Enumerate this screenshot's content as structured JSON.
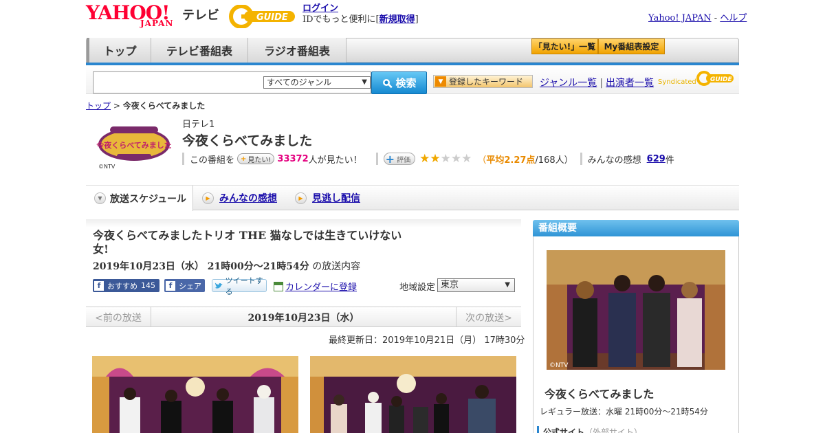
{
  "header": {
    "logo_yahoo": "YAHOO!",
    "logo_japan": "JAPAN",
    "logo_tv": "テレビ",
    "gguide": "G-GUIDE",
    "login_label": "ログイン",
    "login_prompt": "IDでもっと便利に[",
    "signup_label": "新規取得",
    "login_close": "]",
    "yahoo_japan_link": "Yahoo! JAPAN",
    "separator": "-",
    "help_link": "ヘルプ"
  },
  "nav": {
    "tabs": [
      {
        "label": "トップ"
      },
      {
        "label": "テレビ番組表"
      },
      {
        "label": "ラジオ番組表"
      }
    ],
    "mitai_list": "「見たい!」一覧",
    "my_schedule": "My番組表設定"
  },
  "search": {
    "placeholder": "",
    "genre_selected": "すべてのジャンル",
    "button_label": "検索",
    "keyword_button": "登録したキーワード",
    "genre_list_link": "ジャンル一覧",
    "performer_list_link": "出演者一覧",
    "syndicated": "Syndicated",
    "syndicated_brand": "G-GUIDE"
  },
  "breadcrumb": {
    "top": "トップ",
    "sep": ">",
    "current": "今夜くらべてみました"
  },
  "program": {
    "logo_text": "今夜くらべてみました",
    "copyright": "©NTV",
    "channel": "日テレ1",
    "title": "今夜くらべてみました",
    "this_program": "この番組を",
    "mitai_button": "見たい!",
    "mitai_count": "33372",
    "mitai_suffix": "人が見たい！",
    "rating_button": "評価",
    "rating_value": 2.27,
    "rating_stars_max": 5,
    "avg_open": "（",
    "avg_label": "平均2.27点",
    "avg_count": "/168人",
    "avg_close": "）",
    "comments_label": "みんなの感想",
    "comments_count": "629",
    "comments_unit": "件"
  },
  "subtabs": {
    "schedule": "放送スケジュール",
    "reviews": "みんなの感想",
    "streaming": "見逃し配信"
  },
  "episode": {
    "title": "今夜くらべてみましたトリオ THE 猫なしでは生きていけない女!",
    "date": "2019年10月23日（水） 21時00分～21時54分",
    "date_suffix": "の放送内容",
    "fb_recommend": "おすすめ",
    "fb_count": "145",
    "share": "シェア",
    "tweet": "ツイートする",
    "calendar": "カレンダーに登録",
    "region_label": "地域設定",
    "region_value": "東京"
  },
  "pager": {
    "prev": "<前の放送",
    "current": "2019年10月23日（水）",
    "next": "次の放送>"
  },
  "updated": "最終更新日：2019年10月21日（月） 17時30分",
  "sidebar": {
    "heading": "番組概要",
    "photo_copyright": "©NTV",
    "title": "今夜くらべてみました",
    "regular": "レギュラー放送：水曜 21時00分～21時54分",
    "official_site": "公式サイト",
    "external": "（外部サイト）"
  },
  "colors": {
    "yahoo_red": "#ff0033",
    "accent_blue": "#2a86cf",
    "link": "#1a0dab",
    "pink": "#e4007f",
    "orange": "#e98a00"
  }
}
